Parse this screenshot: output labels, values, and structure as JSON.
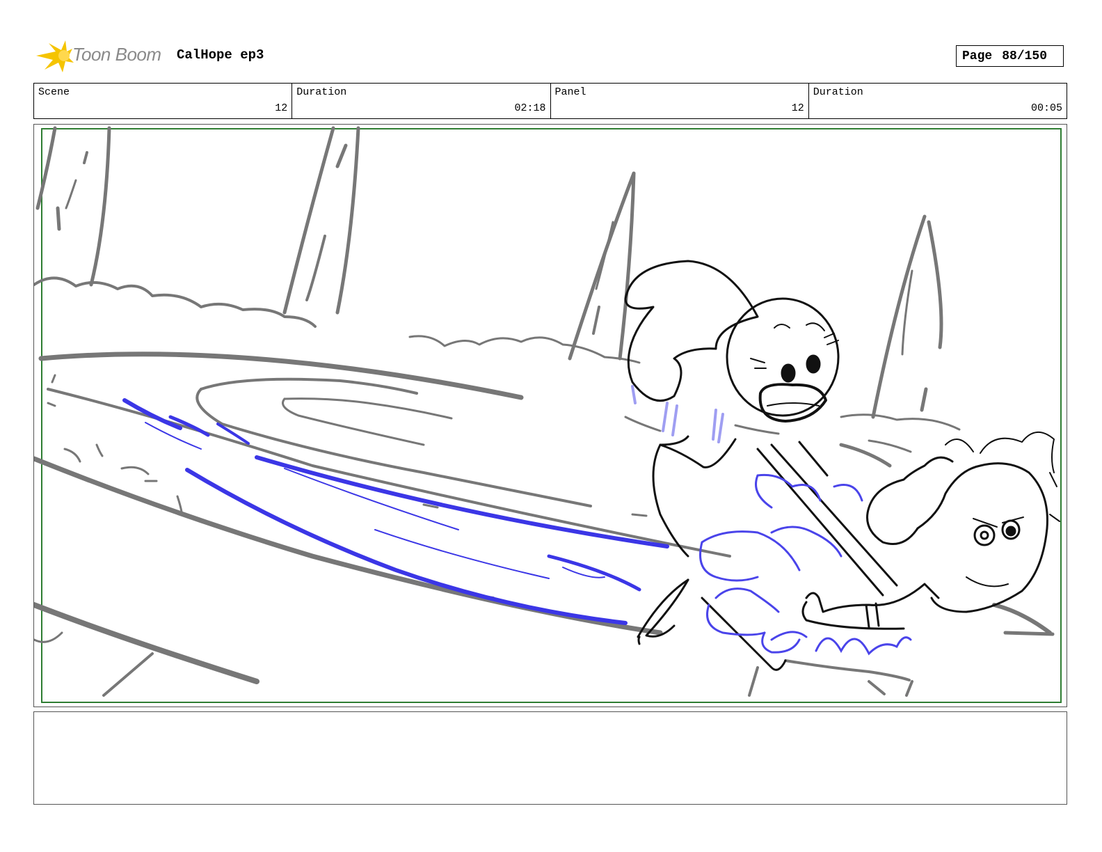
{
  "header": {
    "logo_text": "Toon Boom",
    "project_title": "CalHope ep3",
    "page_label": "Page",
    "page_number": "88/150"
  },
  "info": {
    "scene_label": "Scene",
    "scene_value": "12",
    "scene_duration_label": "Duration",
    "scene_duration_value": "02:18",
    "panel_label": "Panel",
    "panel_value": "12",
    "panel_duration_label": "Duration",
    "panel_duration_value": "00:05"
  },
  "colors": {
    "safe_frame": "#2e7d32",
    "background_lines": "#777777",
    "character_lines": "#111111",
    "motion_lines": "#3b36e6",
    "tone_lines": "#9f9ef2",
    "logo_yellow": "#f5c400"
  },
  "notes": {
    "text": ""
  }
}
